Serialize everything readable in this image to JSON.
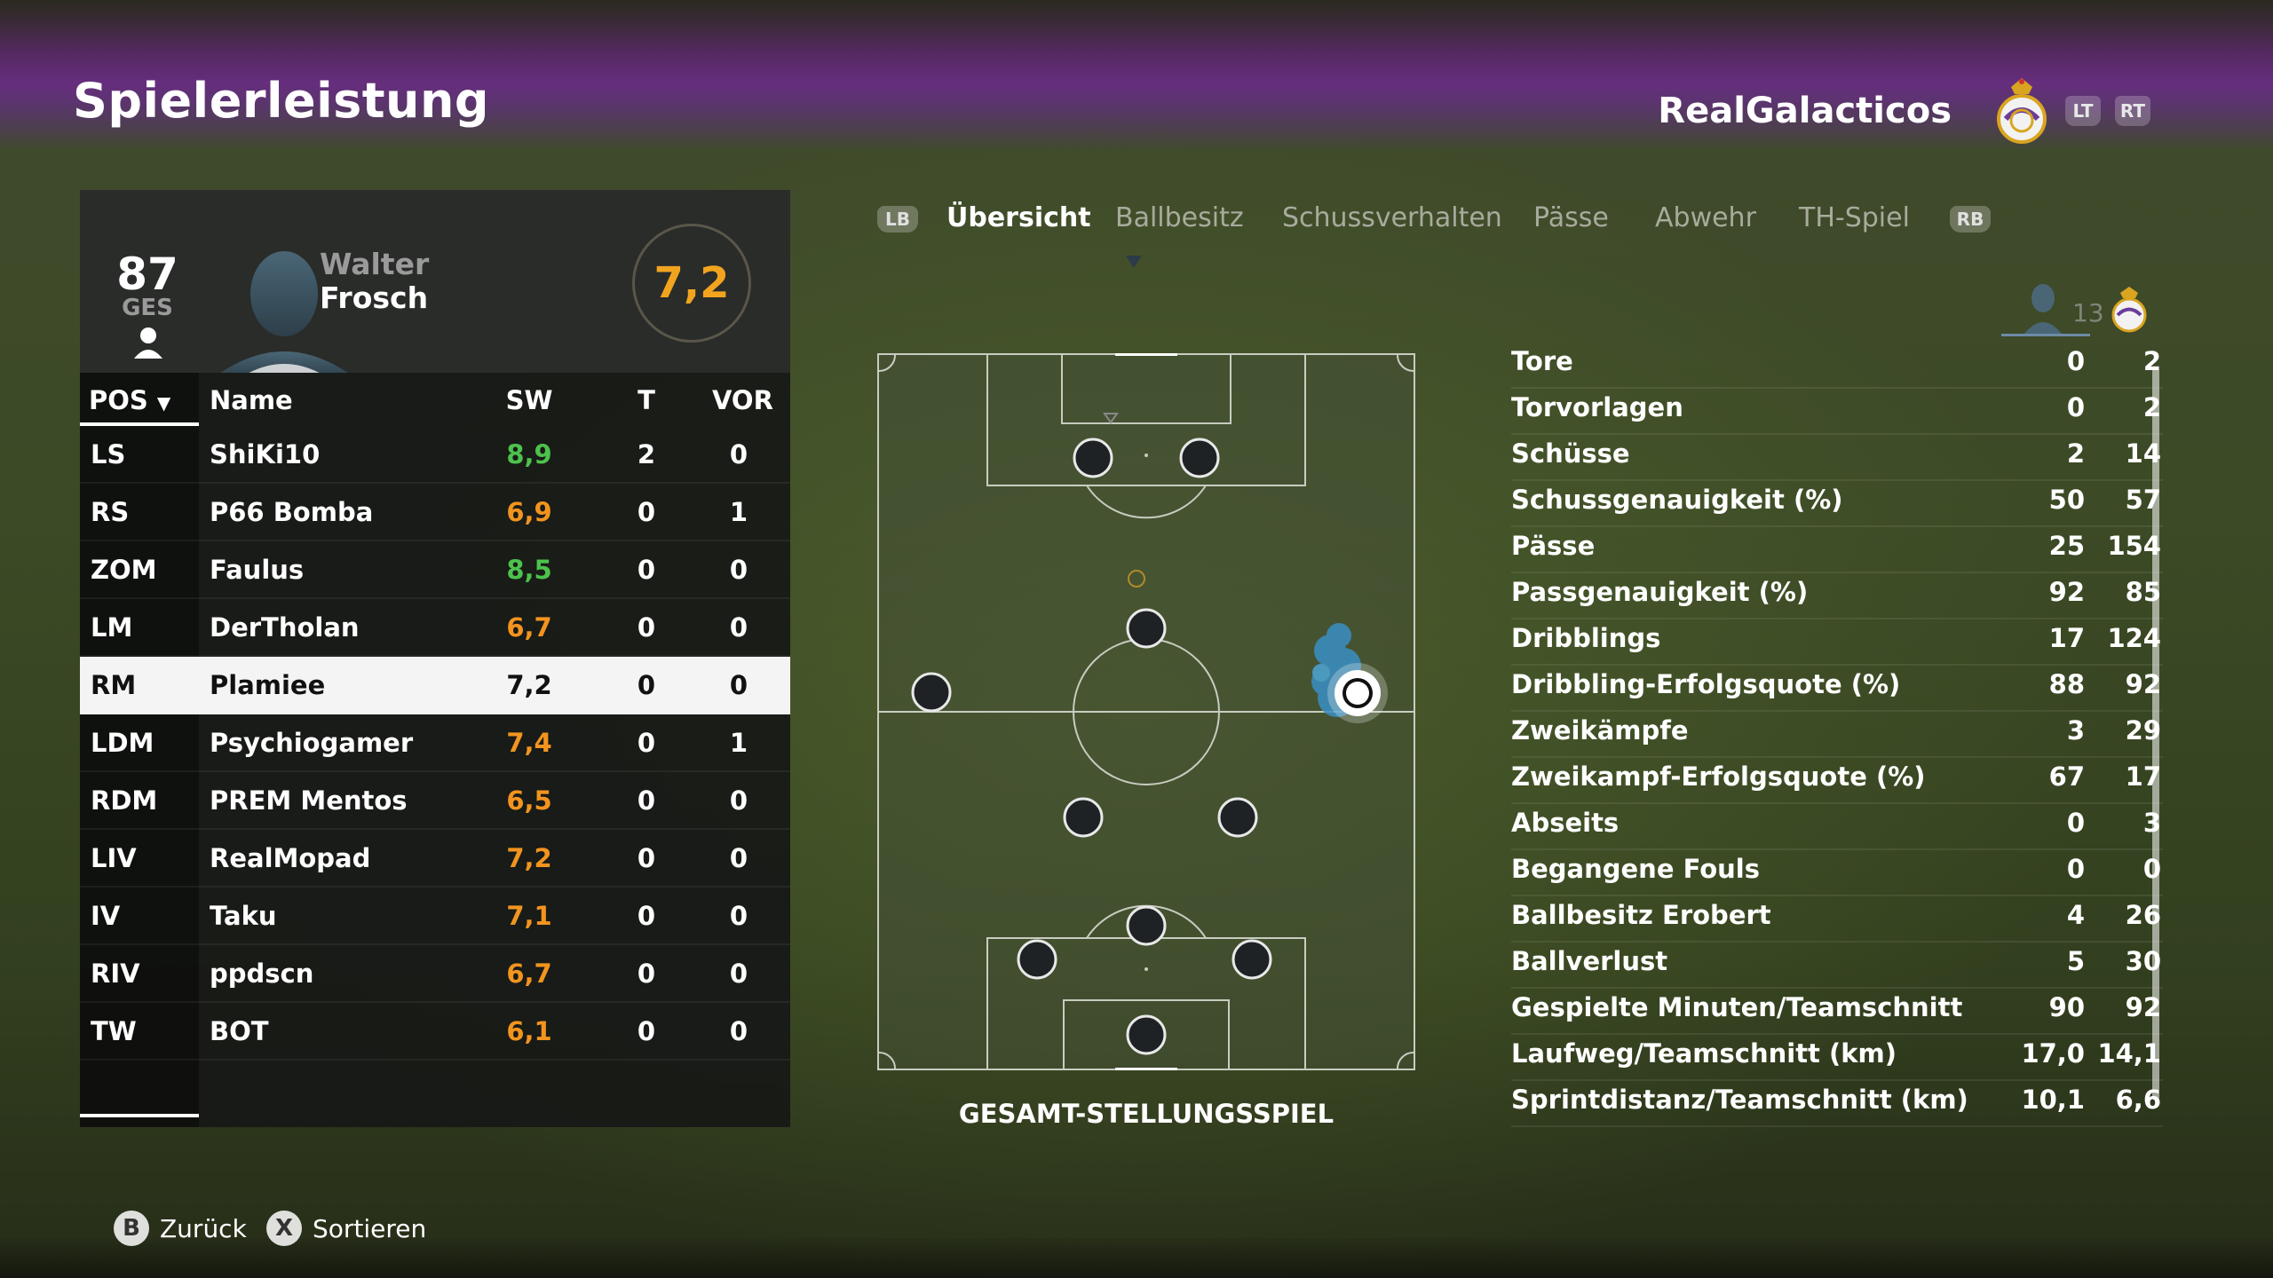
{
  "header": {
    "title": "Spielerleistung",
    "team_name": "RealGalacticos",
    "lt_label": "LT",
    "rt_label": "RT"
  },
  "player_card": {
    "overall": "87",
    "overall_label": "GES",
    "first_name": "Walter",
    "last_name": "Frosch",
    "rating": "7,2"
  },
  "table": {
    "headers": {
      "pos": "POS",
      "name": "Name",
      "sw": "SW",
      "t": "T",
      "vor": "VOR"
    },
    "rows": [
      {
        "pos": "LS",
        "name": "ShiKi10",
        "sw": "8,9",
        "t": "2",
        "vor": "0",
        "sw_color": "green"
      },
      {
        "pos": "RS",
        "name": "P66 Bomba",
        "sw": "6,9",
        "t": "0",
        "vor": "1",
        "sw_color": "orange"
      },
      {
        "pos": "ZOM",
        "name": "Faulus",
        "sw": "8,5",
        "t": "0",
        "vor": "0",
        "sw_color": "green"
      },
      {
        "pos": "LM",
        "name": "DerTholan",
        "sw": "6,7",
        "t": "0",
        "vor": "0",
        "sw_color": "orange"
      },
      {
        "pos": "RM",
        "name": "Plamiee",
        "sw": "7,2",
        "t": "0",
        "vor": "0",
        "sw_color": "black",
        "selected": true
      },
      {
        "pos": "LDM",
        "name": "Psychiogamer",
        "sw": "7,4",
        "t": "0",
        "vor": "1",
        "sw_color": "orange"
      },
      {
        "pos": "RDM",
        "name": "PREM Mentos",
        "sw": "6,5",
        "t": "0",
        "vor": "0",
        "sw_color": "orange"
      },
      {
        "pos": "LIV",
        "name": "RealMopad",
        "sw": "7,2",
        "t": "0",
        "vor": "0",
        "sw_color": "orange"
      },
      {
        "pos": "IV",
        "name": "Taku",
        "sw": "7,1",
        "t": "0",
        "vor": "0",
        "sw_color": "orange"
      },
      {
        "pos": "RIV",
        "name": "ppdscn",
        "sw": "6,7",
        "t": "0",
        "vor": "0",
        "sw_color": "orange"
      },
      {
        "pos": "TW",
        "name": "BOT",
        "sw": "6,1",
        "t": "0",
        "vor": "0",
        "sw_color": "orange"
      }
    ]
  },
  "tabs": {
    "lb_label": "LB",
    "rb_label": "RB",
    "items": [
      "Übersicht",
      "Ballbesitz",
      "Schussverhalten",
      "Pässe",
      "Abwehr",
      "TH-Spiel"
    ],
    "active_index": 0
  },
  "pitch": {
    "caption": "GESAMT-STELLUNGSSPIEL"
  },
  "stats": {
    "header_number": "13",
    "rows": [
      {
        "label": "Tore",
        "player": "0",
        "team": "2"
      },
      {
        "label": "Torvorlagen",
        "player": "0",
        "team": "2"
      },
      {
        "label": "Schüsse",
        "player": "2",
        "team": "14"
      },
      {
        "label": "Schussgenauigkeit (%)",
        "player": "50",
        "team": "57"
      },
      {
        "label": "Pässe",
        "player": "25",
        "team": "154"
      },
      {
        "label": "Passgenauigkeit (%)",
        "player": "92",
        "team": "85"
      },
      {
        "label": "Dribblings",
        "player": "17",
        "team": "124"
      },
      {
        "label": "Dribbling-Erfolgsquote (%)",
        "player": "88",
        "team": "92"
      },
      {
        "label": "Zweikämpfe",
        "player": "3",
        "team": "29"
      },
      {
        "label": "Zweikampf-Erfolgsquote (%)",
        "player": "67",
        "team": "17"
      },
      {
        "label": "Abseits",
        "player": "0",
        "team": "3"
      },
      {
        "label": "Begangene Fouls",
        "player": "0",
        "team": "0"
      },
      {
        "label": "Ballbesitz Erobert",
        "player": "4",
        "team": "26"
      },
      {
        "label": "Ballverlust",
        "player": "5",
        "team": "30"
      },
      {
        "label": "Gespielte Minuten/Teamschnitt",
        "player": "90",
        "team": "92"
      },
      {
        "label": "Laufweg/Teamschnitt (km)",
        "player": "17,0",
        "team": "14,1"
      },
      {
        "label": "Sprintdistanz/Teamschnitt (km)",
        "player": "10,1",
        "team": "6,6"
      }
    ]
  },
  "footer": {
    "back_button": "B",
    "back_label": "Zurück",
    "sort_button": "X",
    "sort_label": "Sortieren"
  },
  "colors": {
    "rating_orange": "#f2a41f",
    "rating_green": "#4cc24c",
    "selected_row": "#f4f4f4"
  }
}
